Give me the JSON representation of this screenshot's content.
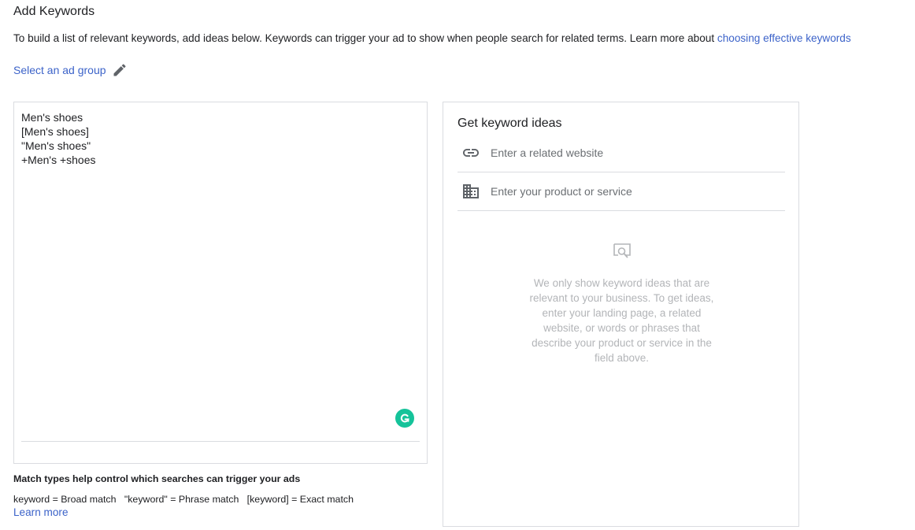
{
  "header": {
    "title": "Add Keywords",
    "intro_text": "To build a list of relevant keywords, add ideas below. Keywords can trigger your ad to show when people search for related terms. Learn more about ",
    "intro_link": "choosing effective keywords"
  },
  "ad_group": {
    "label": "Select an ad group",
    "icon": "pencil-icon"
  },
  "keywords_box": {
    "lines": [
      "Men's shoes",
      "[Men's shoes]",
      "\"Men's shoes\"",
      "+Men's +shoes"
    ],
    "assistant_icon": "grammarly-icon"
  },
  "match_info": {
    "heading": "Match types help control which searches can trigger your ads",
    "types": "keyword = Broad match   \"keyword\" = Phrase match   [keyword] = Exact match",
    "learn_more": "Learn more"
  },
  "ideas_panel": {
    "title": "Get keyword ideas",
    "website_placeholder": "Enter a related website",
    "website_icon": "link-icon",
    "product_placeholder": "Enter your product or service",
    "product_icon": "building-icon",
    "empty_icon": "search-screen-icon",
    "empty_message": "We only show keyword ideas that are relevant to your business. To get ideas, enter your landing page, a related website, or words or phrases that describe your product or service in the field above."
  },
  "colors": {
    "link": "#3c63c9",
    "border": "#dadce0",
    "muted_text": "#b3b5b8",
    "grammarly": "#15c39a"
  }
}
